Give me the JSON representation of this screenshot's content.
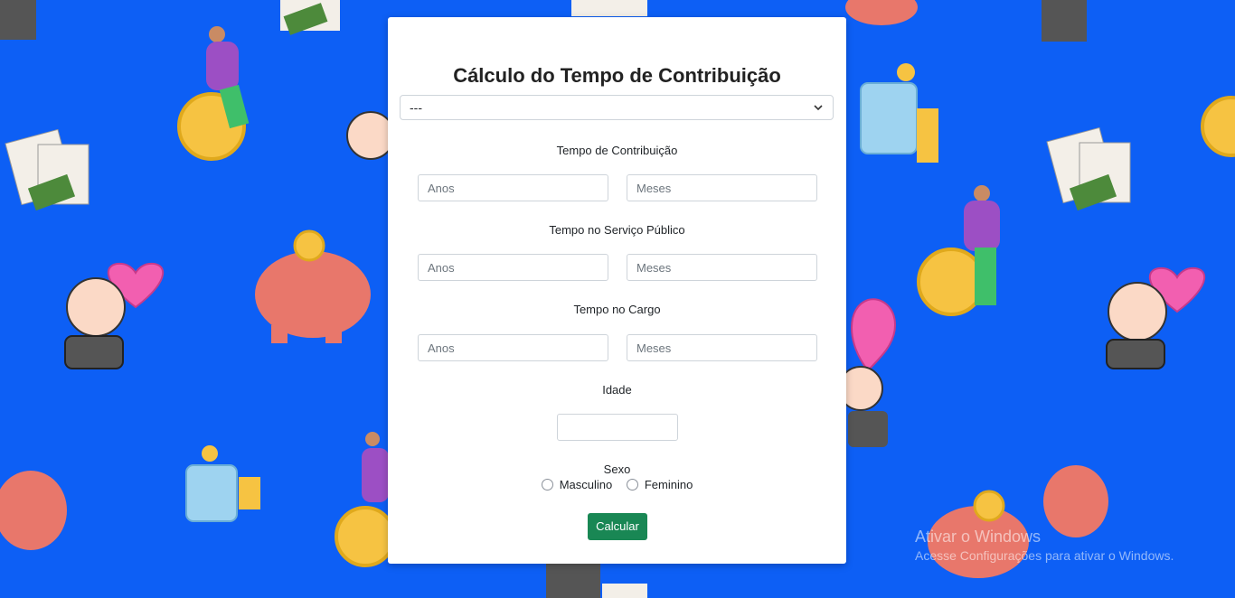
{
  "form": {
    "title": "Cálculo do Tempo de Contribuição",
    "select_value": "---",
    "sections": [
      {
        "label": "Tempo de Contribuição",
        "years_placeholder": "Anos",
        "months_placeholder": "Meses"
      },
      {
        "label": "Tempo no Serviço Público",
        "years_placeholder": "Anos",
        "months_placeholder": "Meses"
      },
      {
        "label": "Tempo no Cargo",
        "years_placeholder": "Anos",
        "months_placeholder": "Meses"
      }
    ],
    "age_label": "Idade",
    "sex_label": "Sexo",
    "sex_options": [
      "Masculino",
      "Feminino"
    ],
    "submit_label": "Calcular"
  },
  "windows_watermark": {
    "title": "Ativar o Windows",
    "subtitle": "Acesse Configurações para ativar o Windows."
  },
  "colors": {
    "background": "#0d5ff5",
    "button": "#198754"
  }
}
